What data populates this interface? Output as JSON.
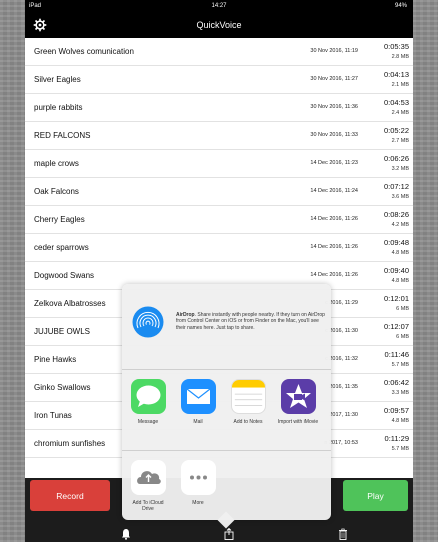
{
  "status_bar": {
    "device": "iPad",
    "time": "14:27",
    "battery": "94%"
  },
  "nav": {
    "title": "QuickVoice"
  },
  "recordings": [
    {
      "name": "Green Wolves comunication",
      "date": "30 Nov 2016, 11:19",
      "duration": "0:05:35",
      "size": "2.8 MB"
    },
    {
      "name": "Silver Eagles",
      "date": "30 Nov 2016, 11:27",
      "duration": "0:04:13",
      "size": "2.1 MB"
    },
    {
      "name": "purple rabbits",
      "date": "30 Nov 2016, 11:36",
      "duration": "0:04:53",
      "size": "2.4 MB"
    },
    {
      "name": "RED FALCONS",
      "date": "30 Nov 2016, 11:33",
      "duration": "0:05:22",
      "size": "2.7 MB"
    },
    {
      "name": "maple crows",
      "date": "14 Dec 2016, 11:23",
      "duration": "0:06:26",
      "size": "3.2 MB"
    },
    {
      "name": "Oak Falcons",
      "date": "14 Dec 2016, 11:24",
      "duration": "0:07:12",
      "size": "3.6 MB"
    },
    {
      "name": "Cherry Eagles",
      "date": "14 Dec 2016, 11:26",
      "duration": "0:08:26",
      "size": "4.2 MB"
    },
    {
      "name": "ceder sparrows",
      "date": "14 Dec 2016, 11:26",
      "duration": "0:09:48",
      "size": "4.8 MB"
    },
    {
      "name": "Dogwood Swans",
      "date": "14 Dec 2016, 11:26",
      "duration": "0:09:40",
      "size": "4.8 MB"
    },
    {
      "name": "Zelkova Albatrosses",
      "date": "c 2016, 11:29",
      "duration": "0:12:01",
      "size": "6 MB"
    },
    {
      "name": "JUJUBE OWLS",
      "date": "c 2016, 11:30",
      "duration": "0:12:07",
      "size": "6 MB"
    },
    {
      "name": "Pine  Hawks",
      "date": "c 2016, 11:32",
      "duration": "0:11:46",
      "size": "5.7 MB"
    },
    {
      "name": "Ginko Swallows",
      "date": "2016, 11:35",
      "duration": "0:06:42",
      "size": "3.3 MB"
    },
    {
      "name": "Iron Tunas",
      "date": "2017, 11:30",
      "duration": "0:09:57",
      "size": "4.8 MB"
    },
    {
      "name": "chromium sunfishes",
      "date": "n 2017, 10:53",
      "duration": "0:11:29",
      "size": "5.7 MB"
    }
  ],
  "share_sheet": {
    "airdrop_title": "AirDrop",
    "airdrop_text": ". Share instantly with people nearby. If they turn on AirDrop from Control Center on iOS or from Finder on the Mac, you'll see their names here. Just tap to share.",
    "apps": [
      {
        "label": "Message",
        "icon": "messages-icon",
        "color": "#4cd964"
      },
      {
        "label": "Mail",
        "icon": "mail-icon",
        "color": "#1e90ff"
      },
      {
        "label": "Add to Notes",
        "icon": "notes-icon",
        "color": "#ffffff"
      },
      {
        "label": "Import with iMovie",
        "icon": "imovie-icon",
        "color": "#5b3da8"
      }
    ],
    "actions": [
      {
        "label": "Add To iCloud Drive",
        "icon": "icloud-upload-icon"
      },
      {
        "label": "More",
        "icon": "more-icon"
      }
    ]
  },
  "bottom": {
    "record_label": "Record",
    "play_label": "Play"
  },
  "colors": {
    "record": "#d9403a",
    "play": "#4fc35a",
    "bar": "#000000"
  }
}
